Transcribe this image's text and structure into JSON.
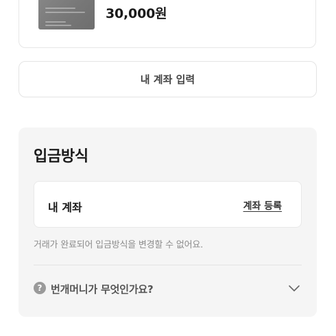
{
  "product": {
    "price": "30,000원"
  },
  "account_input": {
    "label": "내 계좌 입력"
  },
  "deposit_method": {
    "title": "입금방식",
    "account_label": "내 계좌",
    "register_link": "계좌 등록",
    "notice": "거래가 완료되어 입금방식을 변경할 수 없어요.",
    "faq": {
      "icon_glyph": "?",
      "text": "번개머니가 무엇인가요?"
    }
  },
  "icons": {
    "help": "help-circle-icon",
    "expand": "chevron-down-icon"
  },
  "colors": {
    "section_bg": "#f5f5f5",
    "muted_text": "#8c8c8c",
    "border": "#e4e4e4"
  }
}
